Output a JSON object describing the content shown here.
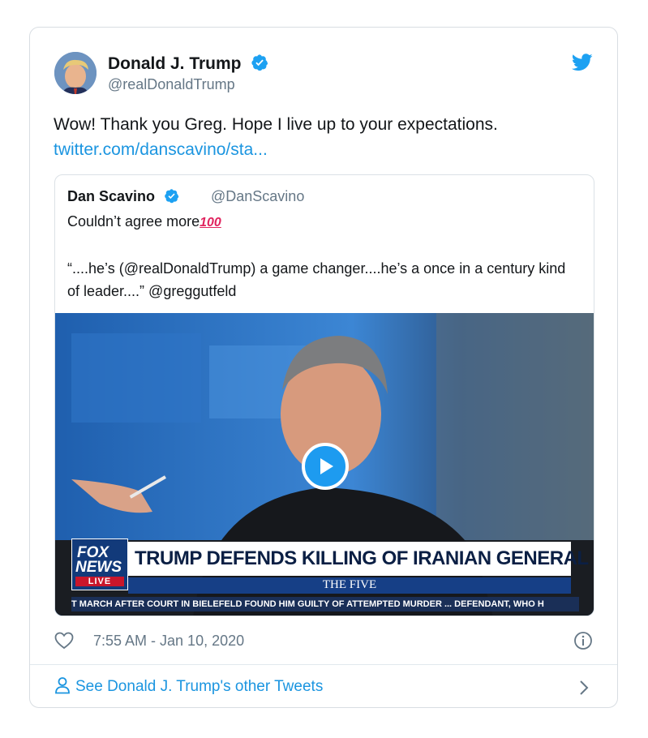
{
  "author": {
    "name": "Donald J. Trump",
    "handle": "@realDonaldTrump"
  },
  "tweet": {
    "text": "Wow! Thank you Greg. Hope I live up to your expectations.",
    "link": "twitter.com/danscavino/sta..."
  },
  "quoted_tweet": {
    "name": "Dan Scavino",
    "handle": "@DanScavino",
    "line1": "Couldn’t agree more",
    "emoji": "100",
    "quote": "“....he’s (@realDonaldTrump) a game changer....he’s a once in a century kind of leader....” @greggutfeld",
    "media": {
      "chyron": "TRUMP DEFENDS KILLING OF IRANIAN GENERAL",
      "network_line1": "FOX",
      "network_line2": "NEWS",
      "network_live": "LIVE",
      "show": "THE FIVE",
      "ticker": "T MARCH AFTER COURT IN BIELEFELD FOUND HIM GUILTY OF ATTEMPTED MURDER ... DEFENDANT, WHO H"
    }
  },
  "meta": {
    "timestamp": "7:55 AM - Jan 10, 2020"
  },
  "footer": {
    "link": "See Donald J. Trump's other Tweets"
  },
  "icons": [
    "verified-icon",
    "twitter-bird-icon",
    "heart-icon",
    "info-icon",
    "person-icon",
    "chevron-right-icon",
    "play-icon"
  ],
  "colors": {
    "link": "#1b95e0",
    "verified": "#1da1f2",
    "secondary_text": "#657786"
  }
}
